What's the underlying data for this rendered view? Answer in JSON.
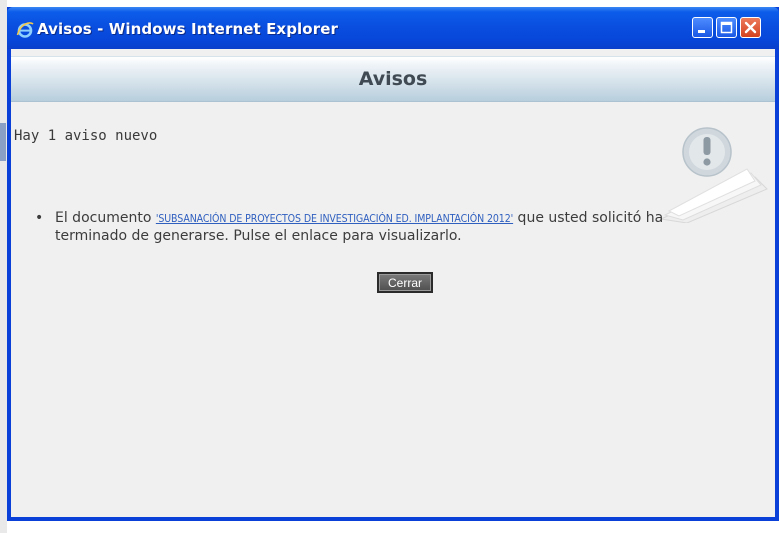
{
  "window": {
    "title": "Avisos - Windows Internet Explorer",
    "icon": "ie-icon",
    "controls": [
      "minimize-icon",
      "maximize-icon",
      "close-icon"
    ]
  },
  "page": {
    "header": "Avisos",
    "count_text": "Hay 1 aviso nuevo",
    "notices": [
      {
        "text_before": "El documento ",
        "link_text": "'SUBSANACIÓN DE PROYECTOS DE INVESTIGACIÓN ED. IMPLANTACIÓN 2012'",
        "text_after": " que usted solicitó ha terminado de generarse. Pulse el enlace para visualizarlo."
      }
    ],
    "close_button": "Cerrar",
    "notice_icon": "exclamation-icon"
  },
  "colors": {
    "title_bar": "#0a4fe0",
    "link": "#2f5fbf",
    "close_button": "#5a5a5a",
    "background": "#f0f0f0"
  }
}
